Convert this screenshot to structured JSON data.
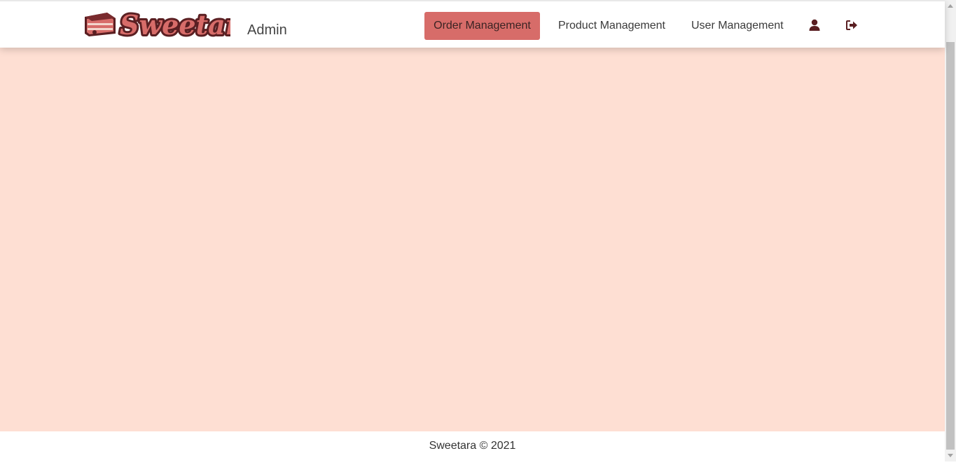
{
  "brand": {
    "logo_text": "Sweetara",
    "role_label": "Admin"
  },
  "nav": {
    "items": [
      {
        "label": "Order Management",
        "active": true
      },
      {
        "label": "Product Management",
        "active": false
      },
      {
        "label": "User Management",
        "active": false
      }
    ],
    "icons": [
      "user-icon",
      "logout-icon"
    ]
  },
  "footer": {
    "text": "Sweetara © 2021"
  },
  "colors": {
    "accent": "#d76c69",
    "content_bg": "#fedfd3",
    "brand_dark": "#5a1f22"
  }
}
